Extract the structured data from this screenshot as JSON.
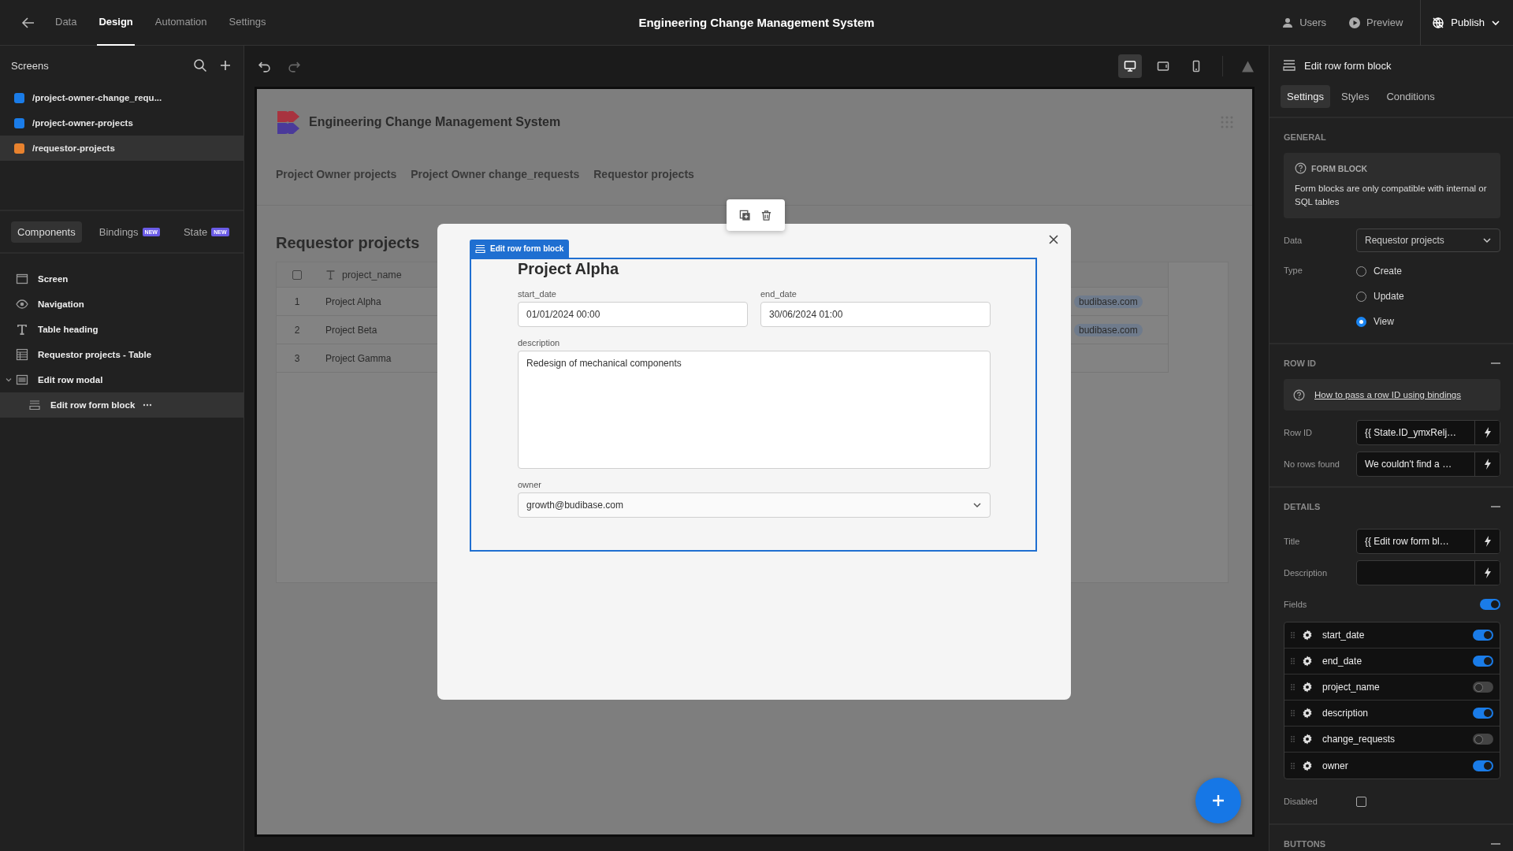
{
  "topbar": {
    "title": "Engineering Change Management System",
    "nav": [
      {
        "label": "Data",
        "selected": false
      },
      {
        "label": "Design",
        "selected": true
      },
      {
        "label": "Automation",
        "selected": false
      },
      {
        "label": "Settings",
        "selected": false
      }
    ],
    "actions": [
      {
        "kind": "users",
        "label": "Users"
      },
      {
        "kind": "preview",
        "label": "Preview"
      },
      {
        "kind": "publish",
        "label": "Publish"
      }
    ]
  },
  "screens": {
    "title": "Screens",
    "items": [
      {
        "path": "/project-owner-change_requ...",
        "color": "#1a7ce8",
        "selected": false
      },
      {
        "path": "/project-owner-projects",
        "color": "#1a7ce8",
        "selected": false
      },
      {
        "path": "/requestor-projects",
        "color": "#e8822e",
        "selected": true
      }
    ]
  },
  "left_tabs": [
    {
      "label": "Components",
      "selected": true
    },
    {
      "label": "Bindings",
      "badge": "NEW",
      "selected": false
    },
    {
      "label": "State",
      "badge": "NEW",
      "selected": false
    }
  ],
  "component_tree": [
    {
      "label": "Screen",
      "kind": "screen",
      "selected": false
    },
    {
      "label": "Navigation",
      "kind": "navigation",
      "selected": false
    },
    {
      "label": "Table heading",
      "kind": "text",
      "selected": false
    },
    {
      "label": "Requestor projects - Table",
      "kind": "table",
      "selected": false
    },
    {
      "label": "Edit row modal",
      "kind": "modal",
      "selected": false,
      "expanded": true,
      "children": [
        {
          "label": "Edit row form block",
          "kind": "form",
          "selected": true
        }
      ]
    }
  ],
  "device_buttons": [
    {
      "kind": "desktop",
      "selected": true
    },
    {
      "kind": "tablet",
      "selected": false
    },
    {
      "kind": "mobile",
      "selected": false
    }
  ],
  "app_preview": {
    "app_title": "Engineering Change Management System",
    "nav_links": [
      "Project Owner projects",
      "Project Owner change_requests",
      "Requestor projects"
    ],
    "heading": "Requestor projects",
    "table": {
      "select_all_checked": false,
      "columns": [
        "project_name"
      ],
      "rows": [
        {
          "number": "1",
          "project_name": "Project Alpha",
          "owner": "budibase.com"
        },
        {
          "number": "2",
          "project_name": "Project Beta",
          "owner": "budibase.com"
        },
        {
          "number": "3",
          "project_name": "Project Gamma"
        }
      ]
    }
  },
  "modal": {
    "block_label": "Edit row form block",
    "title": "Project Alpha",
    "fields": [
      {
        "label": "start_date",
        "kind": "text",
        "value": "01/01/2024 00:00"
      },
      {
        "label": "end_date",
        "kind": "text",
        "value": "30/06/2024 01:00"
      },
      {
        "label": "description",
        "kind": "textarea",
        "value": "Redesign of mechanical components"
      },
      {
        "label": "owner",
        "kind": "select",
        "value": "growth@budibase.com"
      }
    ]
  },
  "settings_panel": {
    "title": "Edit row form block",
    "tabs": [
      {
        "label": "Settings",
        "selected": true
      },
      {
        "label": "Styles",
        "selected": false
      },
      {
        "label": "Conditions",
        "selected": false
      }
    ],
    "general": {
      "heading": "GENERAL",
      "collapsible": false,
      "info_title": "FORM BLOCK",
      "info_text": "Form blocks are only compatible with internal or SQL tables",
      "data_label": "Data",
      "data_value": "Requestor projects",
      "type_label": "Type",
      "type_options": [
        {
          "label": "Create",
          "selected": false
        },
        {
          "label": "Update",
          "selected": false
        },
        {
          "label": "View",
          "selected": true
        }
      ]
    },
    "row_id": {
      "heading": "ROW ID",
      "collapsible": true,
      "help_link": "How to pass a row ID using bindings",
      "inputs": [
        {
          "label": "Row ID",
          "value": "{{ State.ID_ymxRelj…"
        },
        {
          "label": "No rows found",
          "value": "We couldn't find a …"
        }
      ]
    },
    "details": {
      "heading": "DETAILS",
      "collapsible": true,
      "inputs": [
        {
          "label": "Title",
          "value": "{{ Edit row form bl…"
        },
        {
          "label": "Description"
        }
      ],
      "fields_label": "Fields",
      "fields_on": true,
      "fields": [
        {
          "name": "start_date",
          "on": true
        },
        {
          "name": "end_date",
          "on": true
        },
        {
          "name": "project_name",
          "on": false
        },
        {
          "name": "description",
          "on": true
        },
        {
          "name": "change_requests",
          "on": false
        },
        {
          "name": "owner",
          "on": true
        }
      ],
      "disabled_label": "Disabled",
      "disabled_checked": false
    },
    "buttons": {
      "heading": "BUTTONS",
      "collapsible": true
    }
  }
}
